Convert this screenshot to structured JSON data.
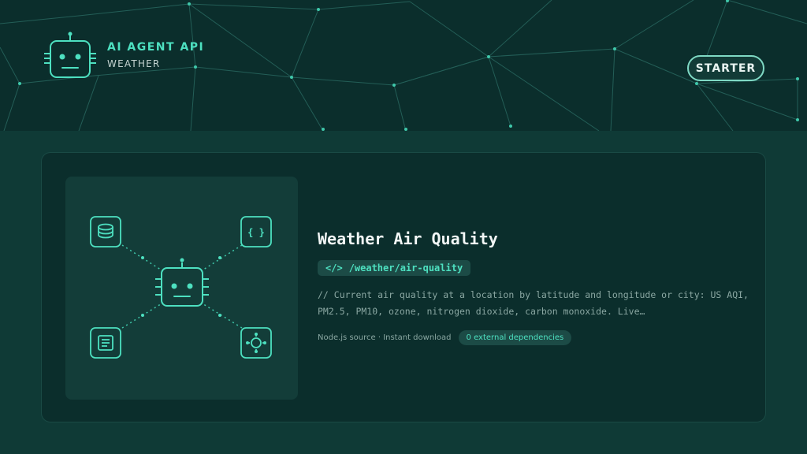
{
  "header": {
    "brand_title": "AI AGENT API",
    "brand_subtitle": "WEATHER",
    "plan_button": "STARTER"
  },
  "card": {
    "title": "Weather Air Quality",
    "endpoint_tag": "</>",
    "endpoint_path": "/weather/air-quality",
    "description": "// Current air quality at a location by latitude and longitude or city: US AQI, PM2.5, PM10, ozone, nitrogen dioxide, carbon monoxide. Live…",
    "meta_text": "Node.js source · Instant download",
    "dependency_badge": "0 external dependencies"
  },
  "icons": [
    "robot-icon",
    "database-icon",
    "code-braces-icon",
    "document-icon",
    "sun-network-icon"
  ],
  "colors": {
    "accent": "#4de0c0",
    "header_bg": "#0b2e2c",
    "page_bg": "#0f3a36",
    "card_bg": "#0b2e2c"
  }
}
